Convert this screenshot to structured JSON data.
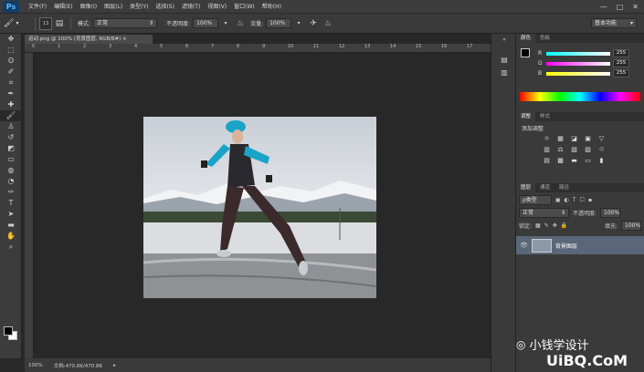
{
  "app": {
    "logo": "Ps"
  },
  "menu": {
    "items": [
      "文件(F)",
      "编辑(E)",
      "图像(I)",
      "图层(L)",
      "类型(Y)",
      "选择(S)",
      "滤镜(T)",
      "视图(V)",
      "窗口(W)",
      "帮助(H)"
    ],
    "window_controls": [
      "—",
      "□",
      "✕"
    ]
  },
  "options": {
    "brush_size": "13",
    "mode_label": "模式:",
    "mode_value": "正常",
    "opacity_label": "不透明度:",
    "opacity_value": "100%",
    "flow_label": "流量:",
    "flow_value": "100%",
    "workspace": "基本功能"
  },
  "document": {
    "tab_title": "运动.png @ 100% (背景图层, RGB/8#) ×",
    "ruler_marks": [
      "0",
      "1",
      "2",
      "3",
      "4",
      "5",
      "6",
      "7",
      "8",
      "9",
      "10",
      "11",
      "12",
      "13",
      "14",
      "15",
      "16",
      "17"
    ],
    "zoom": "100%",
    "doc_size": "文档:470.8K/470.8K"
  },
  "color_panel": {
    "tabs": [
      "颜色",
      "色板"
    ],
    "channels": [
      {
        "label": "R",
        "value": "255",
        "gradient": "linear-gradient(90deg,#00ffff,#ffffff)"
      },
      {
        "label": "G",
        "value": "255",
        "gradient": "linear-gradient(90deg,#ff00ff,#ffffff)"
      },
      {
        "label": "B",
        "value": "255",
        "gradient": "linear-gradient(90deg,#ffff00,#ffffff)"
      }
    ]
  },
  "adjust_panel": {
    "tabs": [
      "调整",
      "样式"
    ],
    "title": "添加调整",
    "row1": [
      "☼",
      "▦",
      "◪",
      "▣",
      "▽",
      ""
    ],
    "row2": [
      "▥",
      "⚖",
      "▧",
      "▨",
      "♲",
      ""
    ],
    "row3": [
      "▤",
      "▩",
      "▬",
      "▭",
      "▮",
      ""
    ]
  },
  "layers_panel": {
    "tabs": [
      "图层",
      "通道",
      "路径"
    ],
    "kind_label": "ρ类型",
    "kind_icons": [
      "▣",
      "◐",
      "T",
      "☐",
      "▪"
    ],
    "blend_mode": "正常",
    "opacity_label": "不透明度:",
    "opacity_value": "100%",
    "lock_label": "锁定:",
    "lock_icons": [
      "▦",
      "✎",
      "✥",
      "🔒"
    ],
    "fill_label": "填充:",
    "fill_value": "100%",
    "layer_name": "背景图层"
  },
  "watermark": {
    "line1": "小钱学设计",
    "line2": "UiBQ.CoM"
  },
  "colors": {
    "accent_layer": "#596778",
    "logo_bg": "#123d6a",
    "logo_fg": "#5db8ff"
  }
}
